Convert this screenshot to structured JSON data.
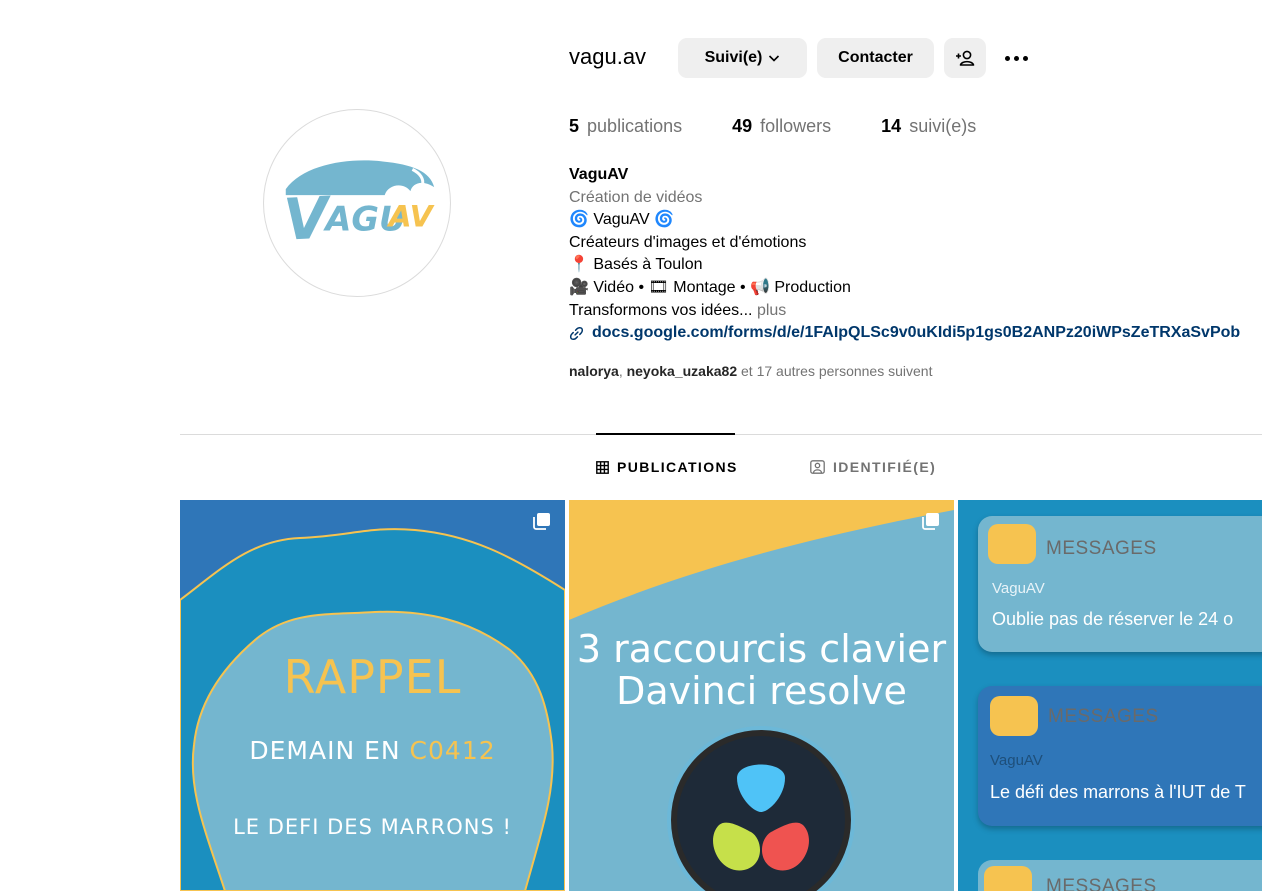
{
  "profile": {
    "username": "vagu.av",
    "follow_button": "Suivi(e)",
    "contact_button": "Contacter",
    "avatar_logo_text": "VAGUAV"
  },
  "stats": {
    "posts_count": "5",
    "posts_label": "publications",
    "followers_count": "49",
    "followers_label": "followers",
    "following_count": "14",
    "following_label": "suivi(e)s"
  },
  "bio": {
    "name": "VaguAV",
    "category": "Création de vidéos",
    "line1": "VaguAV",
    "line1_emoji": "🌀",
    "line2": "Créateurs d'images et d'émotions",
    "line3": "Basés à Toulon",
    "line3_emoji": "📍",
    "line4": "🎥 Vidéo • 🎞 Montage • 📢 Production",
    "line5": "Transformons vos idées...",
    "more": "plus",
    "link": "docs.google.com/forms/d/e/1FAIpQLSc9v0uKIdi5p1gs0B2ANPz20iWPsZeTRXaSvPob"
  },
  "followed_by": {
    "user1": "nalorya",
    "separator": ",",
    "user2": "neyoka_uzaka82",
    "rest": "et 17 autres personnes suivent"
  },
  "tabs": {
    "publications": "PUBLICATIONS",
    "tagged": "IDENTIFIÉ(E)"
  },
  "posts": [
    {
      "title": "RAPPEL",
      "line2_prefix": "DEMAIN EN ",
      "line2_highlight": "C0412",
      "line3": "LE DEFI DES MARRONS !"
    },
    {
      "title_line1": "3 raccourcis clavier",
      "title_line2": "Davinci resolve"
    },
    {
      "cards": [
        {
          "app": "MESSAGES",
          "from": "VaguAV",
          "message": "Oublie pas de réserver le 24 o"
        },
        {
          "app": "MESSAGES",
          "from": "VaguAV",
          "message": "Le défi des marrons à l'IUT de T"
        },
        {
          "app": "MESSAGES"
        }
      ]
    }
  ],
  "colors": {
    "logo_blue": "#74b6cf",
    "logo_yellow": "#f6c350",
    "link": "#00376b",
    "post_blue": "#1b8fbf"
  }
}
